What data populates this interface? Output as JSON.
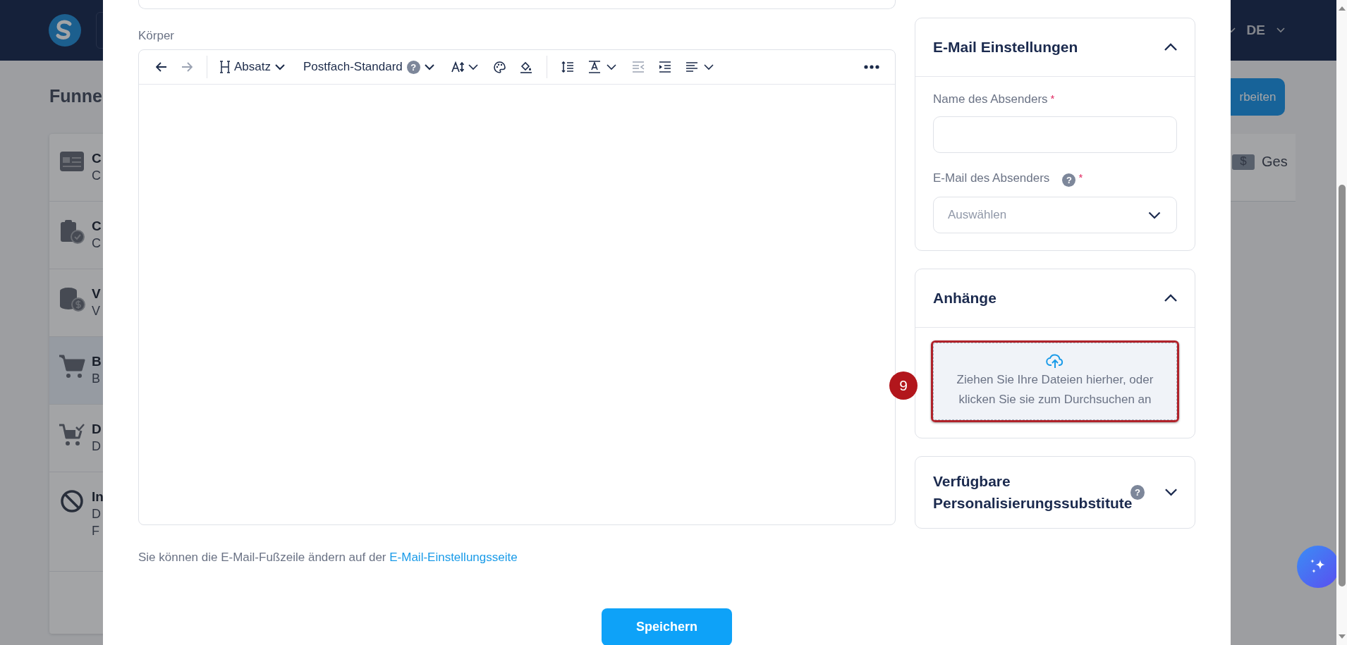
{
  "background_page": {
    "header": {
      "language": "DE"
    },
    "title": "Funne",
    "action_button": "rbeiten",
    "list_items": [
      {
        "kind": "card",
        "title": "C",
        "lines": [
          "C"
        ],
        "selected": false
      },
      {
        "kind": "clipboard",
        "title": "C",
        "lines": [
          "C"
        ],
        "selected": false
      },
      {
        "kind": "coins",
        "title": "V",
        "lines": [
          "V"
        ],
        "selected": false
      },
      {
        "kind": "cart",
        "title": "B",
        "lines": [
          "B"
        ],
        "selected": true
      },
      {
        "kind": "cart-check",
        "title": "D",
        "lines": [
          "D"
        ],
        "selected": false
      },
      {
        "kind": "blocked",
        "title": "In",
        "lines": [
          "D",
          "F"
        ],
        "selected": false
      }
    ],
    "side_card": {
      "badge": "$",
      "label": "Ges"
    }
  },
  "modal": {
    "body_label": "Körper",
    "toolbar": [
      {
        "kind": "undo",
        "disabled": false
      },
      {
        "kind": "redo",
        "disabled": true
      },
      {
        "kind": "separator"
      },
      {
        "kind": "heading",
        "label": "Absatz",
        "disabled": false
      },
      {
        "kind": "font",
        "label": "Postfach-Standard",
        "help": "?",
        "disabled": false
      },
      {
        "kind": "font-size",
        "disabled": false
      },
      {
        "kind": "color",
        "disabled": false
      },
      {
        "kind": "highlight",
        "disabled": false
      },
      {
        "kind": "separator"
      },
      {
        "kind": "line-height",
        "disabled": false
      },
      {
        "kind": "text-color",
        "disabled": false
      },
      {
        "kind": "outdent",
        "disabled": true
      },
      {
        "kind": "indent",
        "disabled": false
      },
      {
        "kind": "align",
        "disabled": false
      },
      {
        "kind": "more",
        "disabled": false
      }
    ],
    "footer_text": "Sie können die E-Mail-Fußzeile ändern auf der",
    "footer_link": "E-Mail-Einstellungsseite",
    "save_button": "Speichern"
  },
  "side_panel": [
    {
      "kind": "fields",
      "title": "E-Mail Einstellungen",
      "expanded": true,
      "fields": [
        {
          "kind": "text",
          "label": "Name des Absenders",
          "required_mark": "*"
        },
        {
          "kind": "select",
          "label": "E-Mail des Absenders",
          "help": "?",
          "required_mark": "*",
          "placeholder": "Auswählen"
        }
      ]
    },
    {
      "kind": "upload",
      "title": "Anhänge",
      "expanded": true,
      "dropzone": {
        "lines": [
          "Ziehen Sie Ihre Dateien hierher, oder",
          "klicken Sie sie zum Durchsuchen an"
        ],
        "highlighted": true
      }
    },
    {
      "kind": "plain",
      "title": "Verfügbare Personalisierungssubstitute",
      "help": "?",
      "expanded": false
    }
  ],
  "step_badge": "9"
}
